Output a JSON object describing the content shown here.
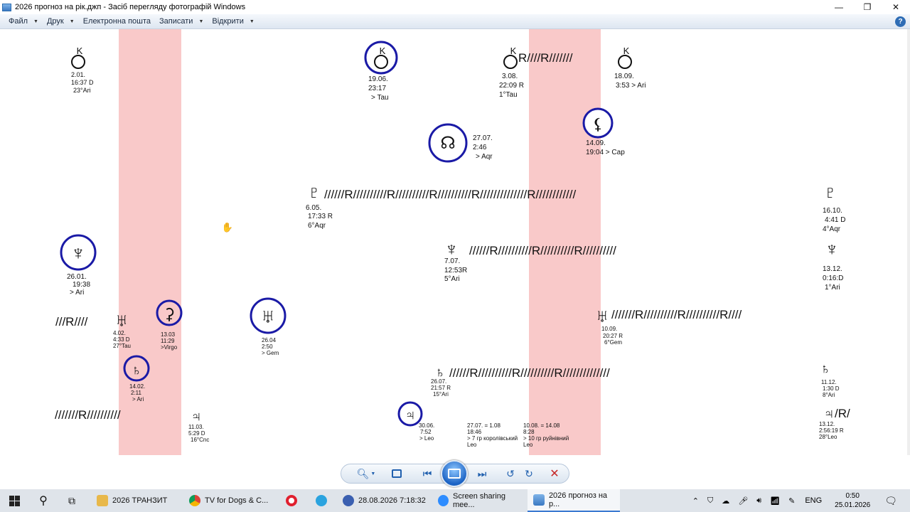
{
  "window": {
    "title": "2026 прогноз на рік.джп - Засіб перегляду фотографій Windows",
    "minimize_glyph": "—",
    "maximize_glyph": "❐",
    "close_glyph": "✕"
  },
  "menu": {
    "items": [
      "Файл",
      "Друк",
      "Електронна пошта",
      "Записати",
      "Відкрити"
    ],
    "help_glyph": "?"
  },
  "chart": {
    "symbols": {
      "chiron": "K",
      "neptune": "♆",
      "pluto": "♇",
      "uranus": "♅",
      "saturn": "♄",
      "jupiter": "♃",
      "node": "☊"
    },
    "chiron_1": [
      "2.01.",
      "16:37 D",
      "23°Ari"
    ],
    "chiron_2": [
      "19.06.",
      "23:17",
      "> Tau"
    ],
    "chiron_3": [
      "3.08.",
      "22:09 R",
      "1°Tau"
    ],
    "chiron_4": [
      "18.09.",
      "3:53 > Ari"
    ],
    "chiron_retro": "R////R///////",
    "node": [
      "27.07.",
      "2:46",
      "> Aqr"
    ],
    "lilith": [
      "14.09.",
      "19:04 > Cap"
    ],
    "pluto_start": [
      "6.05.",
      "17:33 R",
      "6°Aqr"
    ],
    "pluto_end": [
      "16.10.",
      "4:41 D",
      "4°Aqr"
    ],
    "pluto_retro": "//////R//////////R//////////R//////////R//////////////R////////////",
    "neptune_ingress": [
      "26.01.",
      "19:38",
      "> Ari"
    ],
    "neptune_start": [
      "7.07.",
      "12:53R",
      "5°Ari"
    ],
    "neptune_end": [
      "13.12.",
      "0:16:D",
      "1°Ari"
    ],
    "neptune_retro": "//////R//////////R//////////R//////////",
    "uranus_left_retro": "///R////",
    "uranus_direct": [
      "4.02.",
      "4:33 D",
      "27°Tau"
    ],
    "ceres": [
      "13.03",
      "11:29",
      ">Virgo"
    ],
    "uranus_ingress": [
      "26.04",
      "2:50",
      "> Gem"
    ],
    "uranus_start": [
      "10.09.",
      "20:27 R",
      "6°Gem"
    ],
    "uranus_retro": "///////R//////////R//////////R////",
    "saturn_ingress": [
      "14.02.",
      "2:11",
      "> Ari"
    ],
    "saturn_start": [
      "26.07.",
      "21:57 R",
      "15°Ari"
    ],
    "saturn_end": [
      "11.12.",
      "1:30 D",
      "8°Ari"
    ],
    "saturn_retro": "//////R//////////R//////////R//////////////",
    "jupiter_left_retro": "///////R//////////",
    "jupiter_direct": [
      "11.03.",
      "5:29 D",
      "16°Cnc"
    ],
    "jupiter_ingress": [
      "30.06.",
      "7:52",
      "> Leo"
    ],
    "eclipse_1": [
      "27.07.  = 1.08",
      "18:46",
      "> 7 гр королівський",
      "Leo"
    ],
    "eclipse_2": [
      "10.08.  = 14.08",
      "8:28",
      "> 10 гр руйнівний",
      "Leo"
    ],
    "jupiter_end": [
      "13.12.",
      "2:56:19 R",
      "28°Leo"
    ],
    "jupiter_end_retro": "/R/"
  },
  "viewer_controls": {
    "zoom": "zoom-button",
    "fit": "actual-size-button"
  },
  "taskbar": {
    "items": [
      {
        "label": "2026 ТРАНЗИТ"
      },
      {
        "label": "TV for Dogs & C..."
      },
      {
        "label": ""
      },
      {
        "label": ""
      },
      {
        "label": "28.08.2026   7:18:32"
      },
      {
        "label": "Screen sharing mee..."
      },
      {
        "label": "2026 прогноз на р..."
      }
    ],
    "lang": "ENG",
    "time": "0:50",
    "date": "25.01.2026"
  },
  "colors": {
    "band": "#f9c9c9",
    "circle": "#1a1aa6",
    "accent": "#3b7ad1"
  }
}
